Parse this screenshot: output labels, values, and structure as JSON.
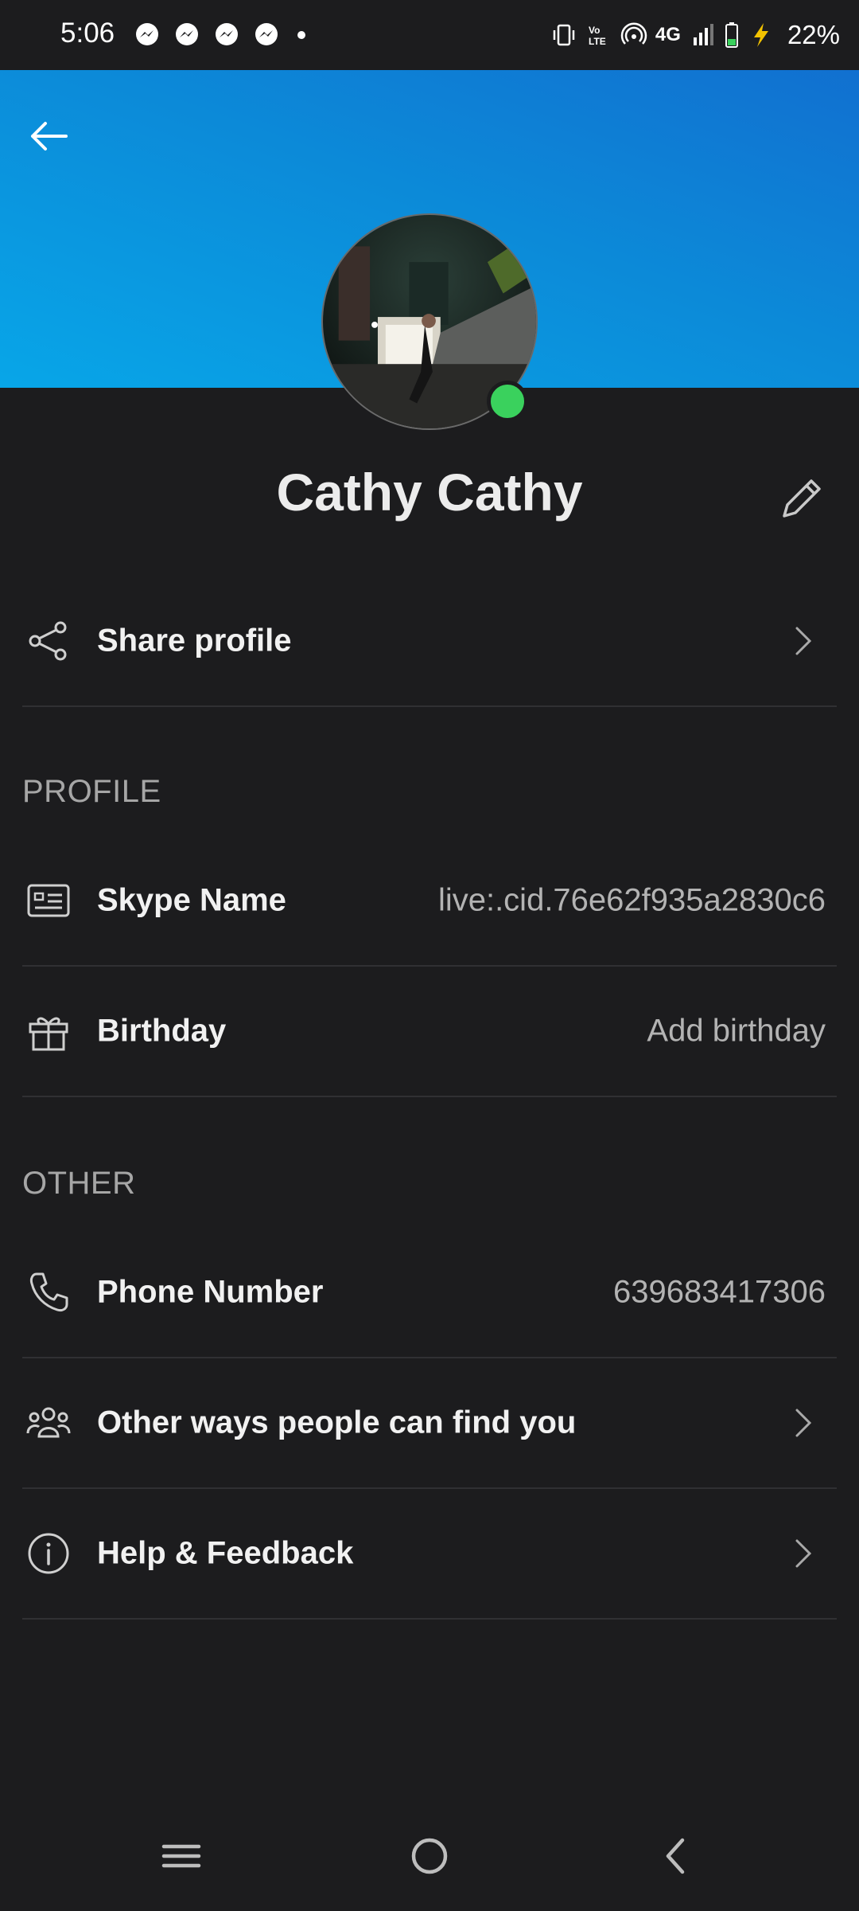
{
  "status_bar": {
    "time": "5:06",
    "notification_icons": [
      "messenger-icon",
      "messenger-icon",
      "messenger-icon",
      "messenger-icon"
    ],
    "network_label": "4G",
    "battery_percent": "22%"
  },
  "colors": {
    "background": "#1c1c1e",
    "banner_gradient_start": "#1170d0",
    "banner_gradient_end": "#08a6e8",
    "presence": "#3ad15d",
    "divider": "#303033"
  },
  "profile": {
    "name": "Cathy Cathy",
    "presence": "online"
  },
  "share_profile": {
    "label": "Share profile",
    "icon": "share-icon"
  },
  "sections": {
    "profile_header": "PROFILE",
    "other_header": "OTHER"
  },
  "profile_rows": {
    "skype_name": {
      "label": "Skype Name",
      "value": "live:.cid.76e62f935a2830c6",
      "icon": "id-card-icon"
    },
    "birthday": {
      "label": "Birthday",
      "value": "Add birthday",
      "icon": "gift-icon"
    }
  },
  "other_rows": {
    "phone": {
      "label": "Phone Number",
      "value": "639683417306",
      "icon": "phone-icon"
    },
    "find_you": {
      "label": "Other ways people can find you",
      "icon": "people-icon"
    },
    "help": {
      "label": "Help & Feedback",
      "icon": "info-icon"
    }
  },
  "nav": {
    "buttons": [
      "recents-icon",
      "home-icon",
      "back-icon"
    ]
  }
}
